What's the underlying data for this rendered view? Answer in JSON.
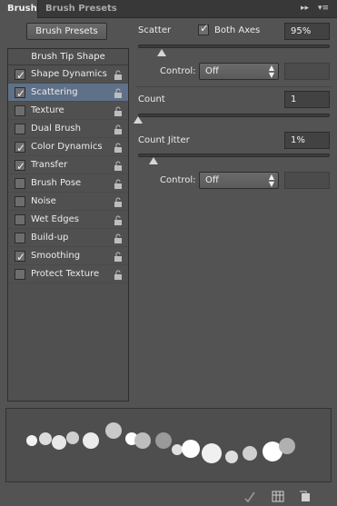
{
  "tabs": [
    {
      "label": "Brush"
    },
    {
      "label": "Brush Presets"
    }
  ],
  "tab_controls": {
    "collapse": "▸▸",
    "menu": "▾≡"
  },
  "presets_button": "Brush Presets",
  "left_panel": {
    "header": "Brush Tip Shape",
    "options": [
      {
        "label": "Shape Dynamics",
        "checked": true
      },
      {
        "label": "Scattering",
        "checked": true,
        "selected": true
      },
      {
        "label": "Texture",
        "checked": false
      },
      {
        "label": "Dual Brush",
        "checked": false
      },
      {
        "label": "Color Dynamics",
        "checked": true
      },
      {
        "label": "Transfer",
        "checked": true
      },
      {
        "label": "Brush Pose",
        "checked": false
      },
      {
        "label": "Noise",
        "checked": false
      },
      {
        "label": "Wet Edges",
        "checked": false
      },
      {
        "label": "Build-up",
        "checked": false
      },
      {
        "label": "Smoothing",
        "checked": true
      },
      {
        "label": "Protect Texture",
        "checked": false
      }
    ]
  },
  "scatter": {
    "label": "Scatter",
    "both_axes_label": "Both Axes",
    "both_axes_checked": true,
    "value": "95%",
    "slider_fraction": 0.05,
    "control_label": "Control:",
    "control_value": "Off"
  },
  "count": {
    "label": "Count",
    "value": "1",
    "slider_fraction": 0.0
  },
  "count_jitter": {
    "label": "Count Jitter",
    "value": "1%",
    "slider_fraction": 0.01,
    "control_label": "Control:",
    "control_value": "Off"
  },
  "colors": {
    "panel": "#535353",
    "selected_row": "#5f7189",
    "tab_bar": "#383838"
  },
  "bottom_icons": [
    "brush-check-icon",
    "grid-icon",
    "new-preset-icon"
  ]
}
